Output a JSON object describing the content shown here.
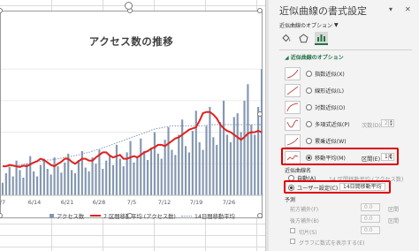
{
  "chart": {
    "title": "アクセス数の推移",
    "legend": {
      "bars_label": "アクセス数",
      "ma7_label": "7 区間移動平均 (アクセス数)",
      "ma14_label": "14日間移動平均"
    },
    "colors": {
      "bar": "#8497b0",
      "ma7": "#e02020",
      "ma14": "#8497b0"
    }
  },
  "chart_data": {
    "type": "bar",
    "title": "アクセス数の推移",
    "x_tick_labels": [
      "/7",
      "6/14",
      "6/21",
      "6/28",
      "7/5",
      "7/12",
      "7/19",
      "7/26"
    ],
    "categories_note": "",
    "series": [
      {
        "name": "アクセス数",
        "type": "bar",
        "values": [
          20,
          35,
          45,
          30,
          55,
          40,
          28,
          50,
          62,
          38,
          30,
          48,
          58,
          42,
          33,
          60,
          46,
          36,
          52,
          66,
          40,
          35,
          56,
          70,
          44,
          38,
          60,
          50,
          72,
          42,
          55,
          64,
          48,
          80,
          58,
          46,
          68,
          86,
          52,
          62,
          90,
          70,
          56,
          74,
          100,
          66,
          58,
          88,
          108,
          72,
          64,
          96,
          120,
          78,
          68,
          102,
          134,
          84,
          72,
          110,
          140,
          92,
          80,
          116,
          150,
          96,
          84,
          124,
          130,
          100,
          150,
          176,
          112,
          96,
          140,
          200
        ]
      },
      {
        "name": "7 区間移動平均 (アクセス数)",
        "type": "line",
        "values": [
          46,
          46,
          48,
          47,
          46,
          45,
          47,
          46,
          49,
          52,
          54,
          58,
          56,
          52,
          48,
          46,
          50,
          53,
          58,
          58,
          53,
          50,
          54,
          58,
          58,
          55,
          55,
          60,
          64,
          68,
          68,
          63,
          60,
          62,
          64,
          58,
          58,
          60,
          62,
          60,
          64,
          68,
          70,
          74,
          76,
          80,
          80,
          78,
          82,
          86,
          90,
          92,
          96,
          100,
          104,
          106,
          108,
          118,
          130,
          132,
          132,
          128,
          122,
          112,
          106,
          102,
          100,
          96,
          92,
          88,
          92,
          98,
          100,
          100,
          102,
          100
        ]
      },
      {
        "name": "14日間移動平均",
        "type": "line",
        "values": [
          46,
          46,
          46,
          47,
          47,
          48,
          49,
          50,
          51,
          52,
          53,
          54,
          55,
          56,
          56,
          57,
          58,
          59,
          60,
          61,
          62,
          63,
          64,
          66,
          67,
          68,
          70,
          72,
          73,
          75,
          77,
          79,
          81,
          83,
          85,
          87,
          89,
          91,
          93,
          95,
          97,
          99,
          101,
          103,
          105,
          106,
          107,
          108,
          109,
          110,
          110,
          110,
          110,
          110,
          110,
          110,
          110,
          110,
          110,
          111,
          112,
          112,
          112,
          112,
          112,
          112,
          112,
          112,
          112,
          112,
          112,
          112,
          112,
          112,
          112,
          112
        ]
      }
    ],
    "grid": true,
    "legend_position": "bottom"
  },
  "pane": {
    "title": "近似曲線の書式設定",
    "subtitle": "近似曲線のオプション",
    "section": "近似曲線のオプション",
    "tabs": [
      "fill-bucket-icon",
      "pentagon-effects-icon",
      "bar-chart-options-icon"
    ],
    "options": [
      {
        "label": "指数近似(X)",
        "selected": false
      },
      {
        "label": "線形近似(L)",
        "selected": false
      },
      {
        "label": "対数近似(O)",
        "selected": false
      },
      {
        "label": "多項式近似(P)",
        "selected": false,
        "extra_label": "次数(D)",
        "extra_value": "2"
      },
      {
        "label": "累乗近似(W)",
        "selected": false
      },
      {
        "label": "移動平均(M)",
        "selected": true,
        "extra_label": "区間(E)",
        "extra_value": "14"
      }
    ],
    "name_group": {
      "heading": "近似曲線名",
      "auto_label": "自動(A)",
      "auto_value": "14 区間移動平均 (アクセス数)",
      "custom_label": "ユーザー設定(C)",
      "custom_value": "14日間移動平均",
      "custom_selected": true
    },
    "forecast": {
      "heading": "予測",
      "forward_label": "前方補外(F)",
      "forward_value": "0.0",
      "forward_unit": "区間",
      "backward_label": "後方補外(B)",
      "backward_value": "0.0",
      "backward_unit": "区間",
      "intercept_label": "切片(S)",
      "intercept_value": "0.0",
      "equation_label": "グラフに数式を表示する(E)"
    }
  }
}
